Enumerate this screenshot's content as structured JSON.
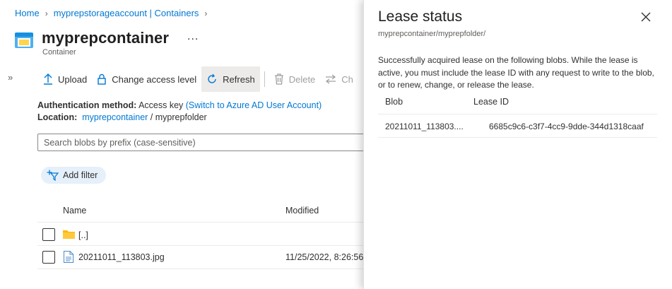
{
  "breadcrumb": {
    "home": "Home",
    "account": "myprepstorageaccount | Containers"
  },
  "header": {
    "title": "myprepcontainer",
    "more": "...",
    "subtitle": "Container"
  },
  "toolbar": {
    "upload": "Upload",
    "change_access": "Change access level",
    "refresh": "Refresh",
    "delete": "Delete",
    "change_truncated": "Ch"
  },
  "auth": {
    "label": "Authentication method:",
    "value": "Access key",
    "switch_link": "(Switch to Azure AD User Account)"
  },
  "location": {
    "label": "Location:",
    "container_link": "myprepcontainer",
    "separator": "/",
    "folder": "myprepfolder"
  },
  "search": {
    "placeholder": "Search blobs by prefix (case-sensitive)"
  },
  "filter": {
    "add_label": "Add filter"
  },
  "table": {
    "columns": {
      "name": "Name",
      "modified": "Modified"
    },
    "rows": [
      {
        "name": "[..]",
        "modified": ""
      },
      {
        "name": "20211011_113803.jpg",
        "modified": "11/25/2022, 8:26:56"
      }
    ]
  },
  "lease_panel": {
    "title": "Lease status",
    "path": "myprepcontainer/myprepfolder/",
    "message": "Successfully acquired lease on the following blobs. While the lease is active, you must include the lease ID with any request to write to the blob, or to renew, change, or release the lease.",
    "columns": {
      "blob": "Blob",
      "lease_id": "Lease ID"
    },
    "rows": [
      {
        "blob": "20211011_113803....",
        "lease_id": "6685c9c6-c3f7-4cc9-9dde-344d1318caaf"
      }
    ]
  },
  "colors": {
    "link": "#0078d4",
    "folder": "#ffb900",
    "add_filter_bg": "#e5f0fa",
    "container_icon": "#1490df"
  }
}
